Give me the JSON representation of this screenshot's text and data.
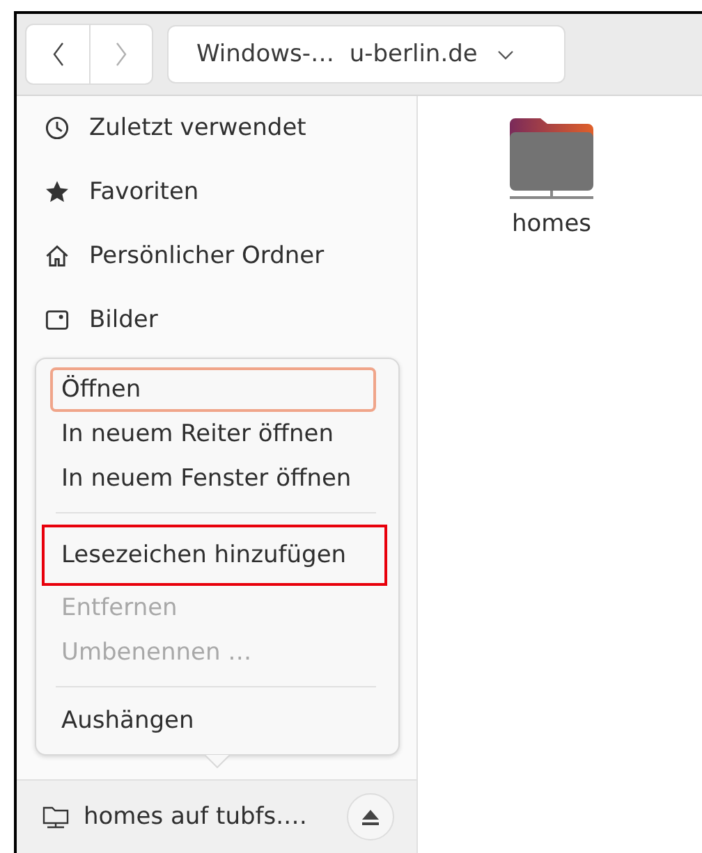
{
  "header": {
    "back_disabled": false,
    "forward_disabled": true,
    "path": "Windows-…  u-berlin.de"
  },
  "sidebar": {
    "items": [
      {
        "label": "Zuletzt verwendet",
        "kind": "recent"
      },
      {
        "label": "Favoriten",
        "kind": "starred"
      },
      {
        "label": "Persönlicher Ordner",
        "kind": "home"
      },
      {
        "label": "Bilder",
        "kind": "pictures"
      }
    ],
    "mount": {
      "label": "homes auf tubfs.…"
    }
  },
  "content": {
    "items": [
      {
        "label": "homes",
        "kind": "network-folder"
      }
    ]
  },
  "context_menu": {
    "items": [
      {
        "label": "Öffnen",
        "disabled": false,
        "focused": true,
        "annotated": false
      },
      {
        "label": "In neuem Reiter öffnen",
        "disabled": false,
        "focused": false,
        "annotated": false
      },
      {
        "label": "In neuem Fenster öffnen",
        "disabled": false,
        "focused": false,
        "annotated": false
      },
      {
        "kind": "separator"
      },
      {
        "label": "Lesezeichen hinzufügen",
        "disabled": false,
        "focused": false,
        "annotated": true
      },
      {
        "label": "Entfernen",
        "disabled": true,
        "focused": false,
        "annotated": false
      },
      {
        "label": "Umbenennen …",
        "disabled": true,
        "focused": false,
        "annotated": false
      },
      {
        "kind": "separator"
      },
      {
        "label": "Aushängen",
        "disabled": false,
        "focused": false,
        "annotated": false
      }
    ]
  }
}
